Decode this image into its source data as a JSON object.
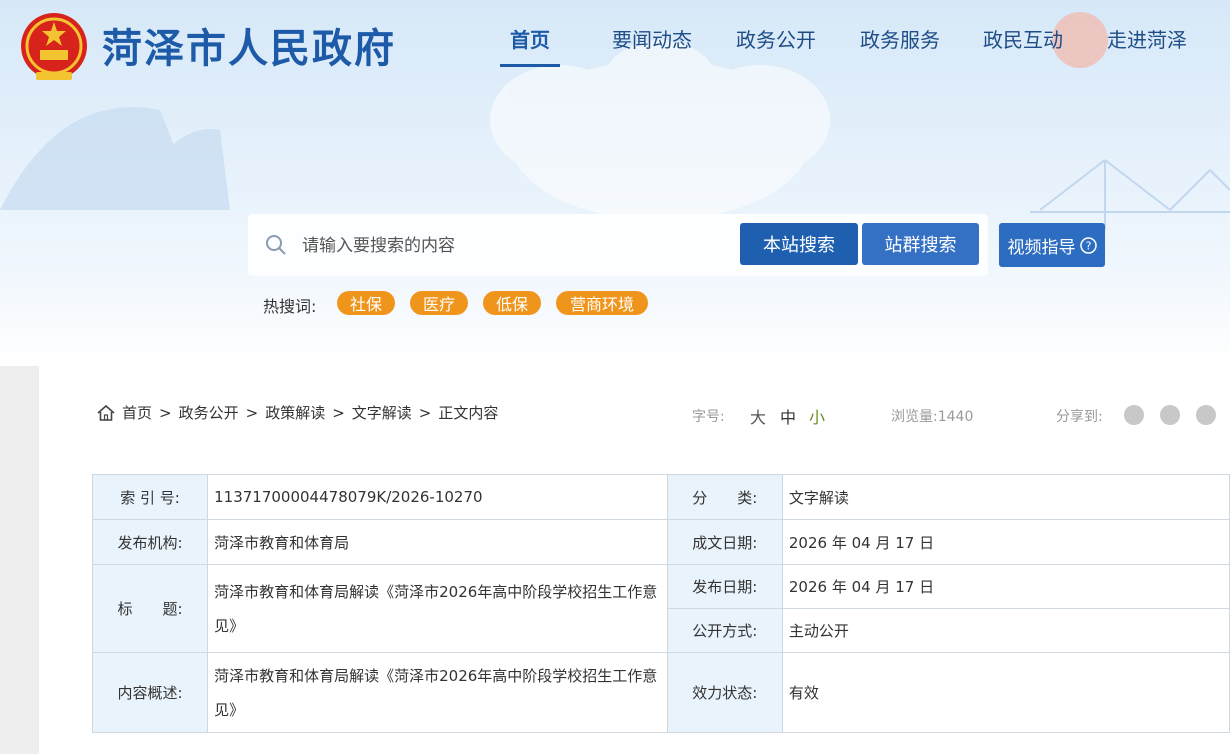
{
  "header": {
    "site_title": "菏泽市人民政府",
    "nav": [
      "首页",
      "要闻动态",
      "政务公开",
      "政务服务",
      "政民互动",
      "走进菏泽"
    ],
    "active_nav": "首页"
  },
  "search": {
    "placeholder": "请输入要搜索的内容",
    "site_search_label": "本站搜索",
    "group_search_label": "站群搜索",
    "video_guide_label": "视频指导",
    "hot_label": "热搜词:",
    "hot_tags": [
      "社保",
      "医疗",
      "低保",
      "营商环境"
    ]
  },
  "breadcrumb": [
    "首页",
    "政务公开",
    "政策解读",
    "文字解读",
    "正文内容"
  ],
  "toolbar": {
    "font_size_label": "字号:",
    "font_sizes": [
      "大",
      "中",
      "小"
    ],
    "views_label": "浏览量:",
    "views_count": "1440",
    "share_label": "分享到:"
  },
  "info": {
    "index_label": "索 引 号:",
    "index_value": "11371700004478079K/2026-10270",
    "category_label": "分　　类:",
    "category_value": "文字解读",
    "publisher_label": "发布机构:",
    "publisher_value": "菏泽市教育和体育局",
    "written_date_label": "成文日期:",
    "written_date_value": "2026 年 04 月 17 日",
    "title_label": "标　　题:",
    "title_value": "菏泽市教育和体育局解读《菏泽市2026年高中阶段学校招生工作意见》",
    "publish_date_label": "发布日期:",
    "publish_date_value": "2026 年 04 月 17 日",
    "open_method_label": "公开方式:",
    "open_method_value": "主动公开",
    "summary_label": "内容概述:",
    "summary_value": "菏泽市教育和体育局解读《菏泽市2026年高中阶段学校招生工作意见》",
    "status_label": "效力状态:",
    "status_value": "有效"
  },
  "colors": {
    "brand_blue": "#1d5aa8",
    "hot_tag_orange": "#f0951c",
    "label_bg": "#e9f3fb"
  }
}
